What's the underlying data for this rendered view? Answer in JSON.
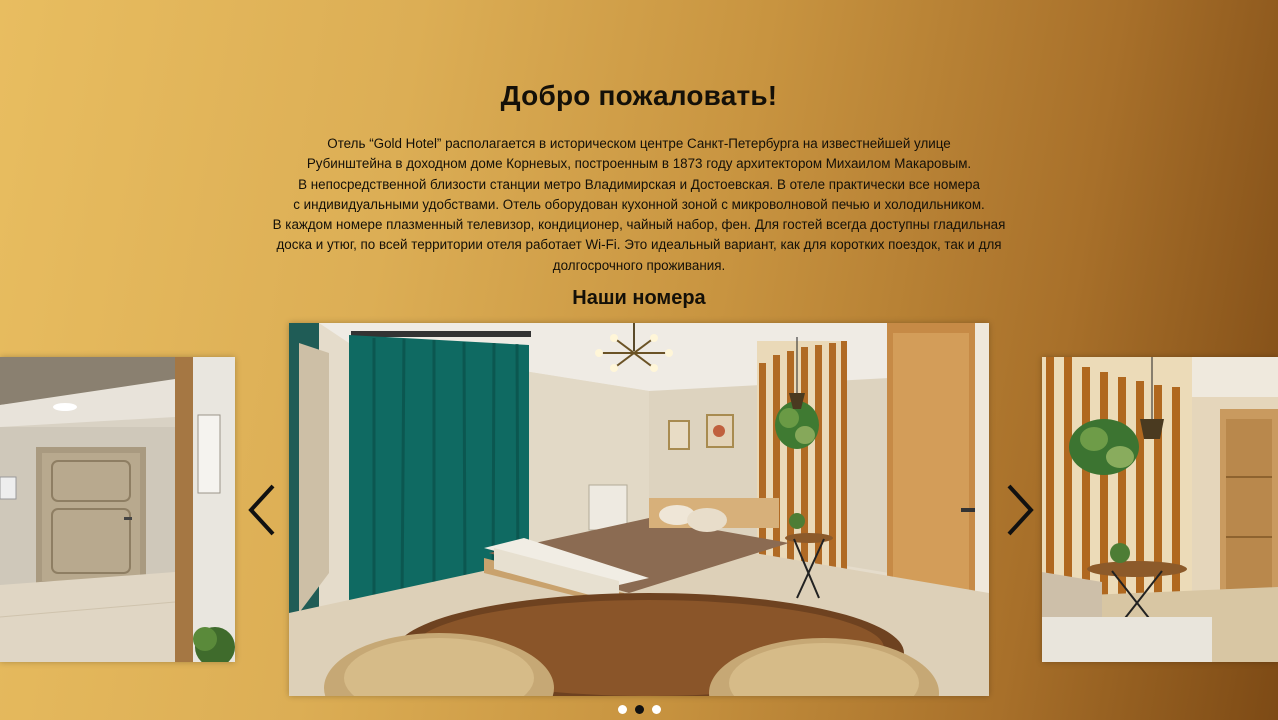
{
  "welcome": {
    "title": "Добро пожаловать!",
    "paragraph_lines": [
      "Отель “Gold Hotel” располагается в историческом центре Санкт-Петербурга на известнейшей улице",
      "Рубинштейна в доходном доме Корневых, построенным в 1873 году архитектором Михаилом Макаровым.",
      "В непосредственной близости станции метро Владимирская и Достоевская. В отеле практически все номера",
      "с индивидуальными удобствами. Отель оборудован кухонной зоной с микроволновой печью и холодильником.",
      "В каждом номере плазменный телевизор, кондиционер, чайный набор, фен. Для гостей всегда доступны гладильная",
      "доска и утюг, по всей территории отеля работает Wi-Fi. Это идеальный вариант, как для коротких поездок, так и для",
      "долгосрочного проживания."
    ]
  },
  "rooms": {
    "title": "Наши номера",
    "carousel": {
      "slide_count": 3,
      "active_index": 1,
      "prev_icon": "chevron-left-icon",
      "next_icon": "chevron-right-icon"
    }
  },
  "colors": {
    "background_light": "#e8bd60",
    "background_dark": "#7d4a15",
    "text": "#141008",
    "dot_inactive": "#ffffff",
    "dot_active": "#111111"
  }
}
